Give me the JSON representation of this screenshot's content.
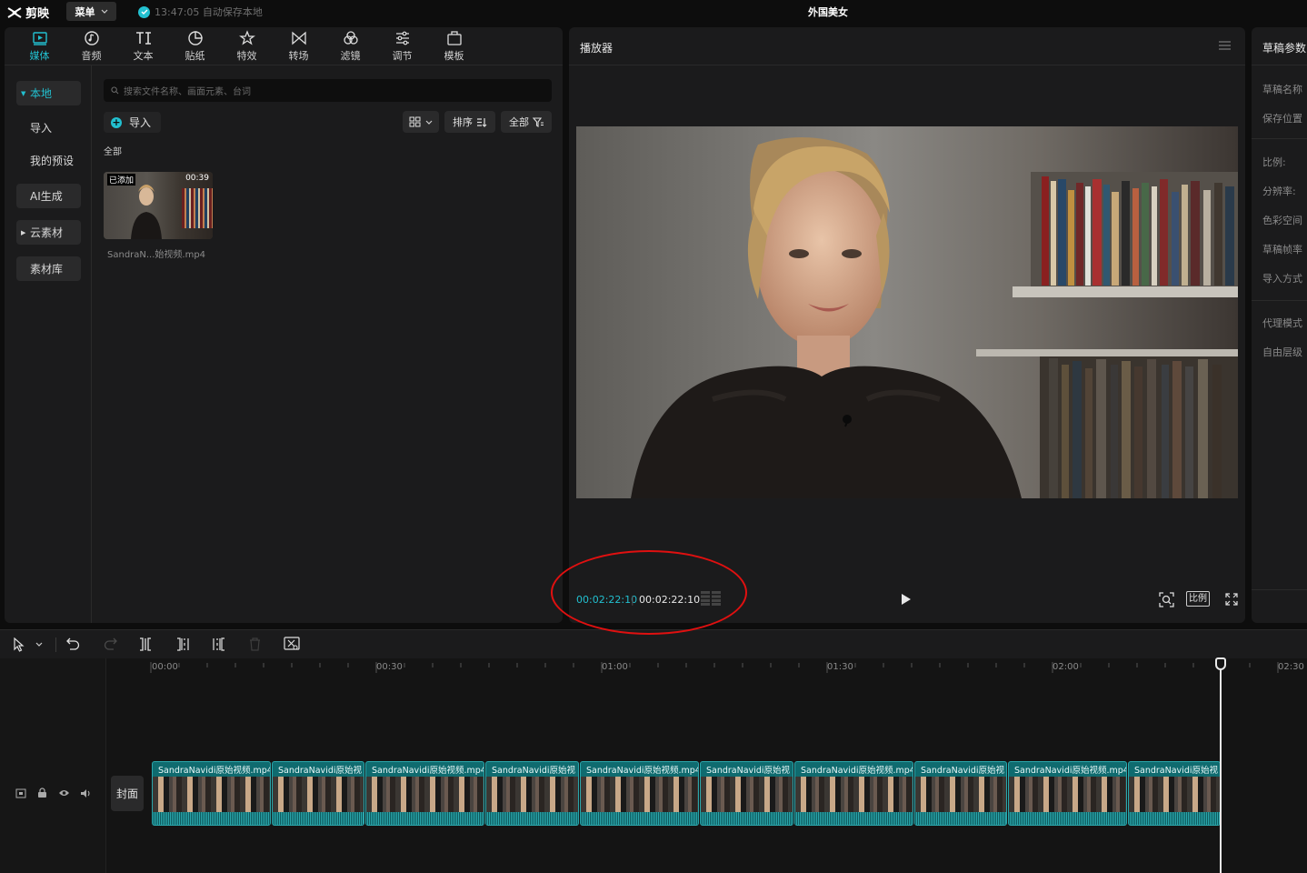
{
  "app": {
    "logo_text": "剪映",
    "menu_label": "菜单",
    "autosave_text": "13:47:05 自动保存本地",
    "doc_title": "外国美女"
  },
  "media_tabs": [
    {
      "label": "媒体",
      "icon": "media-icon",
      "active": true
    },
    {
      "label": "音频",
      "icon": "audio-icon"
    },
    {
      "label": "文本",
      "icon": "text-icon"
    },
    {
      "label": "贴纸",
      "icon": "sticker-icon"
    },
    {
      "label": "特效",
      "icon": "effects-icon"
    },
    {
      "label": "转场",
      "icon": "transition-icon"
    },
    {
      "label": "滤镜",
      "icon": "filter-icon"
    },
    {
      "label": "调节",
      "icon": "adjust-icon"
    },
    {
      "label": "模板",
      "icon": "template-icon"
    }
  ],
  "side_nav": {
    "local": "本地",
    "import": "导入",
    "presets": "我的预设",
    "ai": "AI生成",
    "cloud": "云素材",
    "library": "素材库"
  },
  "search": {
    "placeholder": "搜索文件名称、画面元素、台词"
  },
  "media": {
    "import_label": "导入",
    "sort_label": "排序",
    "filter_label": "全部",
    "all_label": "全部",
    "item": {
      "tag": "已添加",
      "duration": "00:39",
      "name": "SandraN...始视频.mp4"
    }
  },
  "player": {
    "title": "播放器",
    "current_time": "00:02:22:10",
    "total_time": "00:02:22:10",
    "ratio_label": "比例"
  },
  "props": {
    "title": "草稿参数",
    "rows": [
      "草稿名称",
      "保存位置",
      "比例:",
      "分辨率:",
      "色彩空间",
      "草稿帧率",
      "导入方式",
      "代理模式",
      "自由层级"
    ]
  },
  "timeline": {
    "ruler": [
      "00:00",
      "00:30",
      "01:00",
      "01:30",
      "02:00",
      "02:30"
    ],
    "cover_label": "封面",
    "clips": [
      "SandraNavidi原始视频.mp4",
      "SandraNavidi原始视",
      "SandraNavidi原始视频.mp4",
      "SandraNavidi原始视",
      "SandraNavidi原始视频.mp4",
      "SandraNavidi原始视",
      "SandraNavidi原始视频.mp4",
      "SandraNavidi原始视",
      "SandraNavidi原始视频.mp4",
      "SandraNavidi原始视"
    ]
  },
  "colors": {
    "accent": "#22c0d0",
    "clip": "#0f6b6f",
    "annotation": "#e01010"
  }
}
